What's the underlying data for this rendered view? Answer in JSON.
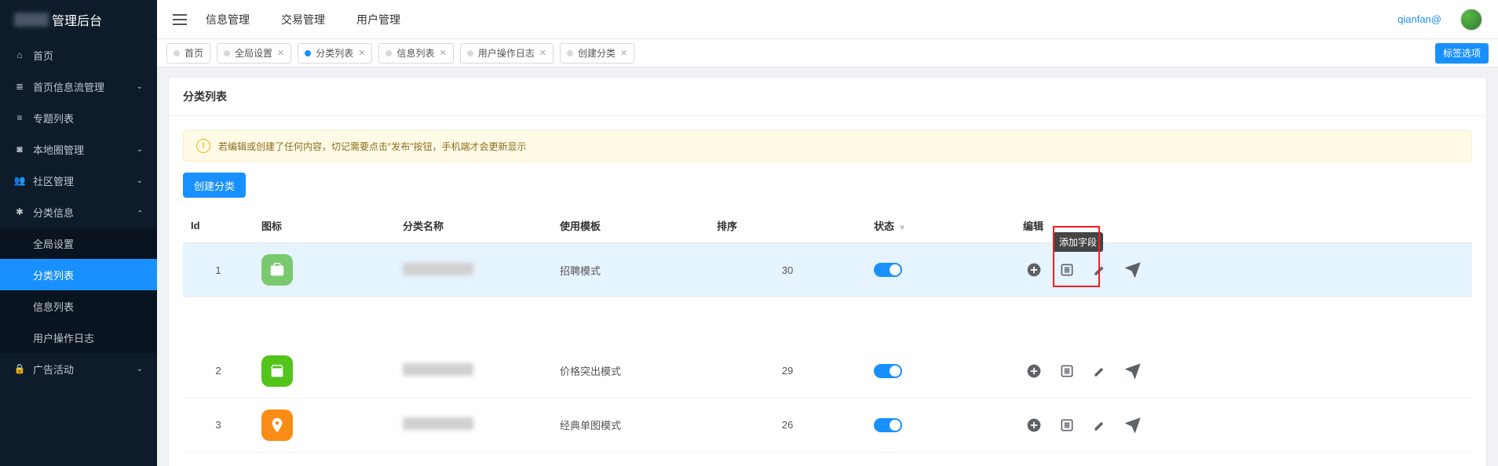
{
  "app": {
    "title_suffix": "管理后台"
  },
  "sidebar": {
    "items": [
      {
        "icon": "home",
        "label": "首页",
        "chev": false
      },
      {
        "icon": "rss",
        "label": "首页信息流管理",
        "chev": true
      },
      {
        "icon": "list",
        "label": "专题列表",
        "chev": false
      },
      {
        "icon": "camera",
        "label": "本地圈管理",
        "chev": true
      },
      {
        "icon": "users",
        "label": "社区管理",
        "chev": true
      },
      {
        "icon": "star",
        "label": "分类信息",
        "chev": true,
        "expanded": true
      },
      {
        "icon": "lock",
        "label": "广告活动",
        "chev": true
      }
    ],
    "sublabels": {
      "global": "全局设置",
      "catlist": "分类列表",
      "infolist": "信息列表",
      "oplog": "用户操作日志"
    }
  },
  "topnav": {
    "info": "信息管理",
    "trade": "交易管理",
    "user": "用户管理"
  },
  "user": {
    "name": "qianfan@"
  },
  "tabs": {
    "items": [
      {
        "label": "首页",
        "closable": false,
        "active": false
      },
      {
        "label": "全局设置",
        "closable": true,
        "active": false
      },
      {
        "label": "分类列表",
        "closable": true,
        "active": true
      },
      {
        "label": "信息列表",
        "closable": true,
        "active": false
      },
      {
        "label": "用户操作日志",
        "closable": true,
        "active": false
      },
      {
        "label": "创建分类",
        "closable": true,
        "active": false
      }
    ],
    "options_label": "标签选项"
  },
  "page": {
    "title": "分类列表",
    "alert": "若编辑或创建了任何内容，切记需要点击\"发布\"按钮，手机端才会更新显示",
    "create_btn": "创建分类",
    "tooltip": "添加字段",
    "columns": {
      "id": "Id",
      "icon": "图标",
      "name": "分类名称",
      "template": "使用模板",
      "sort": "排序",
      "status": "状态",
      "edit": "编辑"
    },
    "rows": [
      {
        "id": "1",
        "icon": "JOB",
        "iconClass": "ic-green1",
        "template": "招聘模式",
        "sort": "30",
        "status": true
      },
      {
        "id": "2",
        "icon": "SHOP",
        "iconClass": "ic-green2",
        "template": "价格突出模式",
        "sort": "29",
        "status": true
      },
      {
        "id": "3",
        "icon": "PIN",
        "iconClass": "ic-orange",
        "template": "经典单图模式",
        "sort": "26",
        "status": true
      }
    ]
  }
}
